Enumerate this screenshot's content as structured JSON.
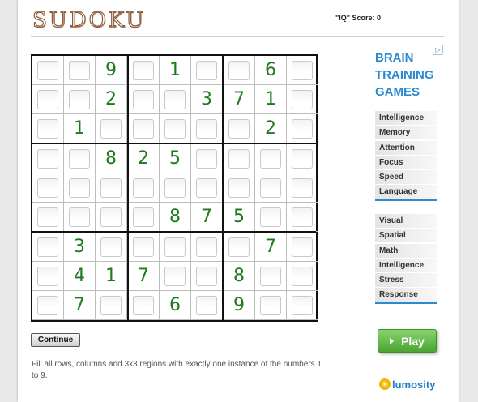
{
  "header": {
    "logo_text": "SUDOKU",
    "score_text": "\"IQ\" Score: 0"
  },
  "puzzle": {
    "rows": [
      [
        "",
        "",
        "9",
        "",
        "1",
        "",
        "",
        "6",
        ""
      ],
      [
        "",
        "",
        "2",
        "",
        "",
        "3",
        "7",
        "1",
        ""
      ],
      [
        "",
        "1",
        "",
        "",
        "",
        "",
        "",
        "2",
        ""
      ],
      [
        "",
        "",
        "8",
        "2",
        "5",
        "",
        "",
        "",
        ""
      ],
      [
        "",
        "",
        "",
        "",
        "",
        "",
        "",
        "",
        ""
      ],
      [
        "",
        "",
        "",
        "",
        "8",
        "7",
        "5",
        "",
        ""
      ],
      [
        "",
        "3",
        "",
        "",
        "",
        "",
        "",
        "7",
        ""
      ],
      [
        "",
        "4",
        "1",
        "7",
        "",
        "",
        "8",
        "",
        ""
      ],
      [
        "",
        "7",
        "",
        "",
        "6",
        "",
        "9",
        "",
        ""
      ]
    ]
  },
  "controls": {
    "continue_label": "Continue"
  },
  "instructions": "Fill all rows, columns and 3x3 regions with exactly one instance of the numbers 1 to 9.",
  "ad": {
    "badge": "▷",
    "title_lines": [
      "BRAIN",
      "TRAINING",
      "GAMES"
    ],
    "group1": [
      "Intelligence",
      "Memory",
      "Attention",
      "Focus",
      "Speed",
      "Language"
    ],
    "group2": [
      "Visual",
      "Spatial",
      "Math",
      "Intelligence",
      "Stress",
      "Response"
    ],
    "play_label": "Play",
    "brand": "lumosity"
  },
  "colors": {
    "given_digit": "#1d7a1d",
    "ad_accent": "#2e8ad0",
    "play_button": "#4aa531"
  }
}
